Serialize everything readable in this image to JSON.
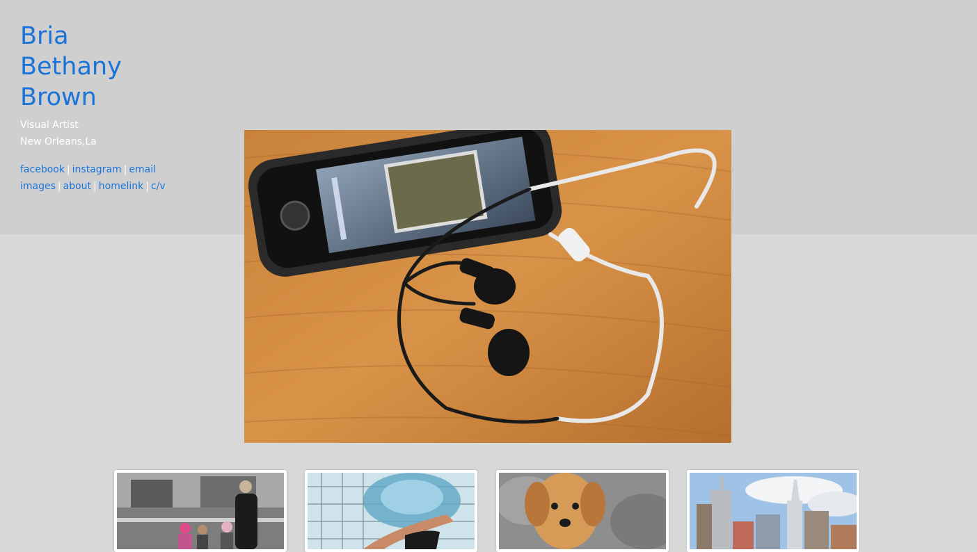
{
  "header": {
    "name_lines": [
      "Bria",
      "Bethany",
      "Brown"
    ],
    "role": "Visual Artist",
    "location": "New Orleans,La"
  },
  "nav": {
    "row1": [
      "facebook",
      "instagram",
      "email"
    ],
    "row2": [
      "images",
      "about",
      "homelink",
      "c/v"
    ],
    "separator": "|"
  },
  "hero": {
    "icon": "phone-earbuds-photo"
  },
  "thumbnails": [
    {
      "icon": "family-street-photo"
    },
    {
      "icon": "swimmer-underwater-photo"
    },
    {
      "icon": "puppy-photo"
    },
    {
      "icon": "city-skyline-photo"
    }
  ],
  "colors": {
    "accent": "#1a73d8",
    "top_band": "#cfcfcf",
    "page_bg": "#d8d8d8"
  }
}
